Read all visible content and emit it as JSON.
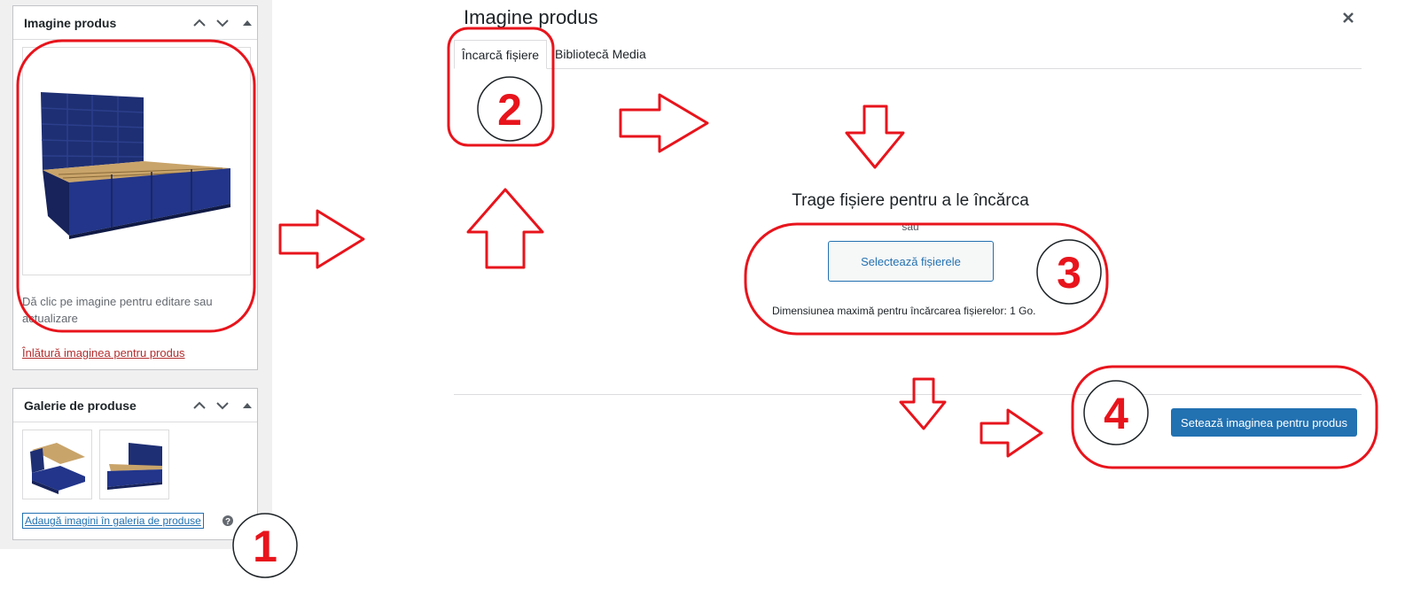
{
  "product_image_box": {
    "title": "Imagine produs",
    "hint": "Dă clic pe imagine pentru editare sau actualizare",
    "remove_link": "Înlătură imaginea pentru produs"
  },
  "gallery_box": {
    "title": "Galerie de produse",
    "add_link": "Adaugă imagini în galeria de produse"
  },
  "modal": {
    "title": "Imagine produs",
    "tabs": [
      {
        "label": "Încarcă fișiere",
        "active": true
      },
      {
        "label": "Bibliotecă Media",
        "active": false
      }
    ],
    "drop_text": "Trage fișiere pentru a le încărca",
    "or_text": "sau",
    "select_button": "Selectează fișierele",
    "max_size": "Dimensiunea maximă pentru încărcarea fișierelor: 1 Go.",
    "set_button": "Setează imaginea pentru produs"
  },
  "annotations": {
    "steps": [
      "1",
      "2",
      "3",
      "4"
    ],
    "color": "#e8141c"
  },
  "colors": {
    "accent": "#2271b1",
    "danger_link": "#b32d2e",
    "bed_fabric": "#1e2f73",
    "bed_slats": "#c9a46a"
  }
}
